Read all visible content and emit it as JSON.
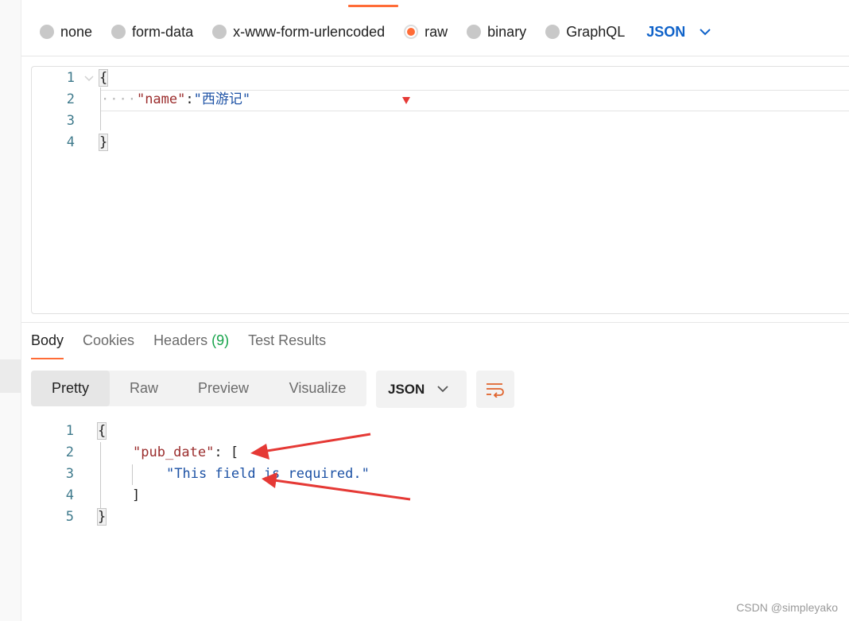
{
  "body_modes": [
    {
      "label": "none",
      "selected": false
    },
    {
      "label": "form-data",
      "selected": false
    },
    {
      "label": "x-www-form-urlencoded",
      "selected": false
    },
    {
      "label": "raw",
      "selected": true
    },
    {
      "label": "binary",
      "selected": false
    },
    {
      "label": "GraphQL",
      "selected": false
    }
  ],
  "body_language": "JSON",
  "request_editor": {
    "line_numbers": [
      "1",
      "2",
      "3",
      "4"
    ],
    "open_brace": "{",
    "close_brace": "}",
    "indent_dots": "····",
    "key": "\"name\"",
    "colon": ":",
    "value": "\"西游记\""
  },
  "response_tabs": [
    {
      "label": "Body",
      "active": true
    },
    {
      "label": "Cookies",
      "active": false
    },
    {
      "label": "Headers",
      "count": "(9)",
      "active": false
    },
    {
      "label": "Test Results",
      "active": false
    }
  ],
  "view_modes": [
    {
      "label": "Pretty",
      "active": true
    },
    {
      "label": "Raw",
      "active": false
    },
    {
      "label": "Preview",
      "active": false
    },
    {
      "label": "Visualize",
      "active": false
    }
  ],
  "response_language": "JSON",
  "response_viewer": {
    "line_numbers": [
      "1",
      "2",
      "3",
      "4",
      "5"
    ],
    "open_brace": "{",
    "key": "\"pub_date\"",
    "colon_bracket": ": [",
    "message": "\"This field is required.\"",
    "close_bracket": "]",
    "close_brace": "}"
  },
  "icons": {
    "dropdown": "chevron-down-icon",
    "wrap": "wrap-lines-icon"
  },
  "colors": {
    "accent": "#ff6c37",
    "link_blue": "#0f62c9",
    "count_green": "#16a34a",
    "annotation_red": "#e53935"
  },
  "watermark": "CSDN @simpleyako"
}
